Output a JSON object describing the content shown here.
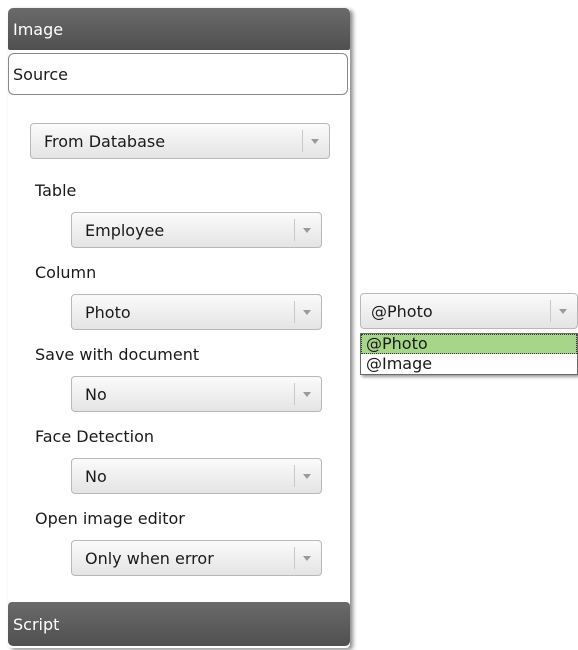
{
  "panel": {
    "header_title": "Image",
    "source_tab": "Source",
    "footer_title": "Script",
    "source_dropdown": "From Database",
    "fields": [
      {
        "label": "Table",
        "value": "Employee"
      },
      {
        "label": "Column",
        "value": "Photo"
      },
      {
        "label": "Save with document",
        "value": "No"
      },
      {
        "label": "Face Detection",
        "value": "No"
      },
      {
        "label": "Open image editor",
        "value": "Only when error"
      }
    ]
  },
  "popup": {
    "selected_value": "@Photo",
    "options": [
      {
        "label": "@Photo",
        "selected": true
      },
      {
        "label": "@Image",
        "selected": false
      }
    ],
    "highlight_color": "#a7d58a"
  },
  "icons": {
    "dropdown_arrow": "chevron-down-icon"
  }
}
